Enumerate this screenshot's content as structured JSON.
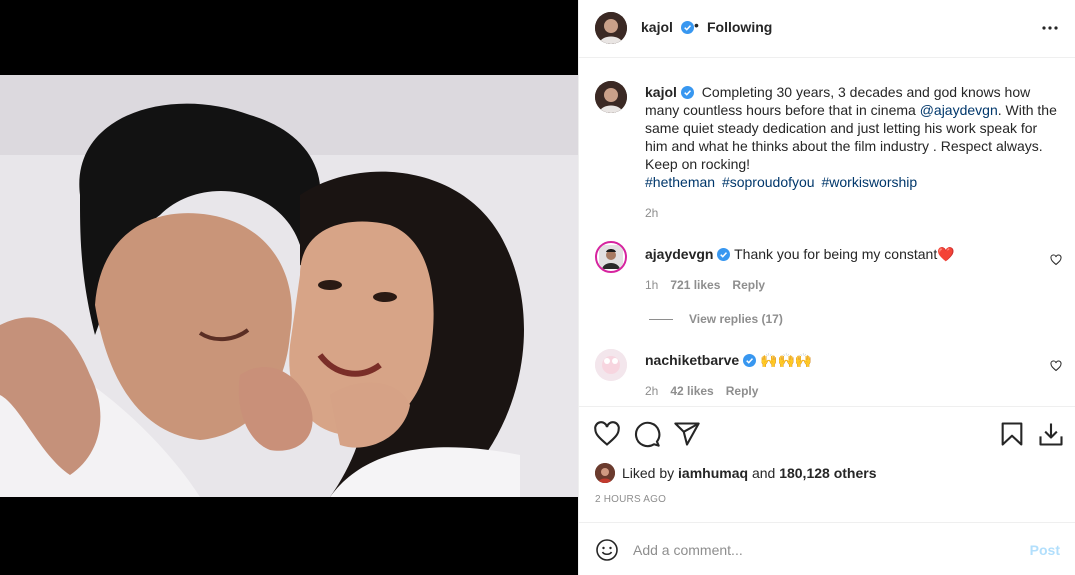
{
  "post": {
    "author": "kajol",
    "follow_status": "Following",
    "separator": "•",
    "caption": {
      "text_before_mention": "Completing 30 years, 3 decades and god knows how many countless hours before that in cinema ",
      "mention": "@ajaydevgn",
      "text_after_mention": ". With the same quiet steady dedication and just letting his work speak for him and what he thinks about the film industry . Respect always. Keep on rocking!",
      "hashtags": [
        "#hetheman",
        "#soproudofyou",
        "#workisworship"
      ],
      "time": "2h"
    },
    "comments": [
      {
        "username": "ajaydevgn",
        "text": "Thank you for being my constant",
        "emoji": "❤️",
        "time": "1h",
        "likes": "721 likes",
        "reply_label": "Reply",
        "view_replies": "View replies (17)"
      },
      {
        "username": "nachiketbarve",
        "text": "",
        "emoji": "🙌🙌🙌",
        "time": "2h",
        "likes": "42 likes",
        "reply_label": "Reply"
      }
    ],
    "likes": {
      "prefix": "Liked by",
      "user": "iamhumaq",
      "connector": "and",
      "others": "180,128 others"
    },
    "timestamp": "2 HOURS AGO"
  },
  "add_comment": {
    "placeholder": "Add a comment...",
    "post_label": "Post"
  },
  "colors": {
    "verified": "#3897f0",
    "link": "#00376b",
    "heart": "#ed4956",
    "post_disabled": "#b2dffc"
  },
  "icons": [
    "more-options-icon",
    "verified-badge-icon",
    "heart-icon",
    "comment-icon",
    "share-icon",
    "save-icon",
    "download-icon",
    "emoji-icon"
  ]
}
